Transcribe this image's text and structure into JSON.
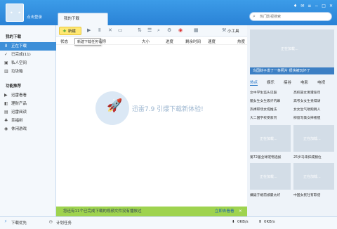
{
  "header": {
    "login_text": "点击登录",
    "tab_label": "我的下载",
    "search_placeholder": "热门影视搜索",
    "window_icons": [
      "shirt-icon",
      "message-icon",
      "menu-icon",
      "minimize-icon",
      "maximize-icon",
      "close-icon"
    ]
  },
  "sidebar": {
    "section1": "我的下载",
    "items1": [
      {
        "label": "正在下载",
        "icon": "download-icon",
        "active": true
      },
      {
        "label": "已完成(11)",
        "icon": "check-icon"
      },
      {
        "label": "私人空间",
        "icon": "lock-icon"
      },
      {
        "label": "垃圾箱",
        "icon": "trash-icon"
      }
    ],
    "section2": "功能推荐",
    "items2": [
      {
        "label": "迅雷看看",
        "icon": "play-icon"
      },
      {
        "label": "理财产品",
        "icon": "wallet-icon"
      },
      {
        "label": "迅雷阅读",
        "icon": "book-icon"
      },
      {
        "label": "幸福树",
        "icon": "tree-icon"
      },
      {
        "label": "休闲游戏",
        "icon": "game-icon"
      }
    ]
  },
  "toolbar": {
    "new_label": "新建",
    "tooltip": "新建下载任务",
    "small_tools": "小工具"
  },
  "columns": [
    "状态",
    "名称",
    "大小",
    "进度",
    "剩余时间",
    "速度",
    "热度"
  ],
  "main": {
    "empty_text": "迅雷7.9 引爆下载新体验!",
    "banner_msg": "您还有11个已完成下载的视频文件没有播放过",
    "banner_action": "立即去看看"
  },
  "right": {
    "loading": "正在加载...",
    "caption1": "鸟国财子发了一条照片  很快被玩坏了",
    "tabs": [
      "热点",
      "娱乐",
      "搞谷",
      "电影",
      "电视"
    ],
    "news": [
      "女中学生监头见殴",
      "高校篇女寓遭惩罚",
      "腼女生女生吸许内幕",
      "高考女女生觉得请",
      "热裸职场女堤推法",
      "女女生气助跑跳人",
      "大二国学校受家罚",
      "柳窗写美女捧楼胆"
    ],
    "captions": [
      "第72届全球宠物选拔",
      "25岁马来抹咸翻位",
      "嫌疑于婚前被最太好",
      "中国女民社有欺倍"
    ]
  },
  "status": {
    "left1": "下载优先",
    "left2": "计划任务",
    "speed_down": "0KB/s",
    "speed_up": "0KB/s"
  }
}
